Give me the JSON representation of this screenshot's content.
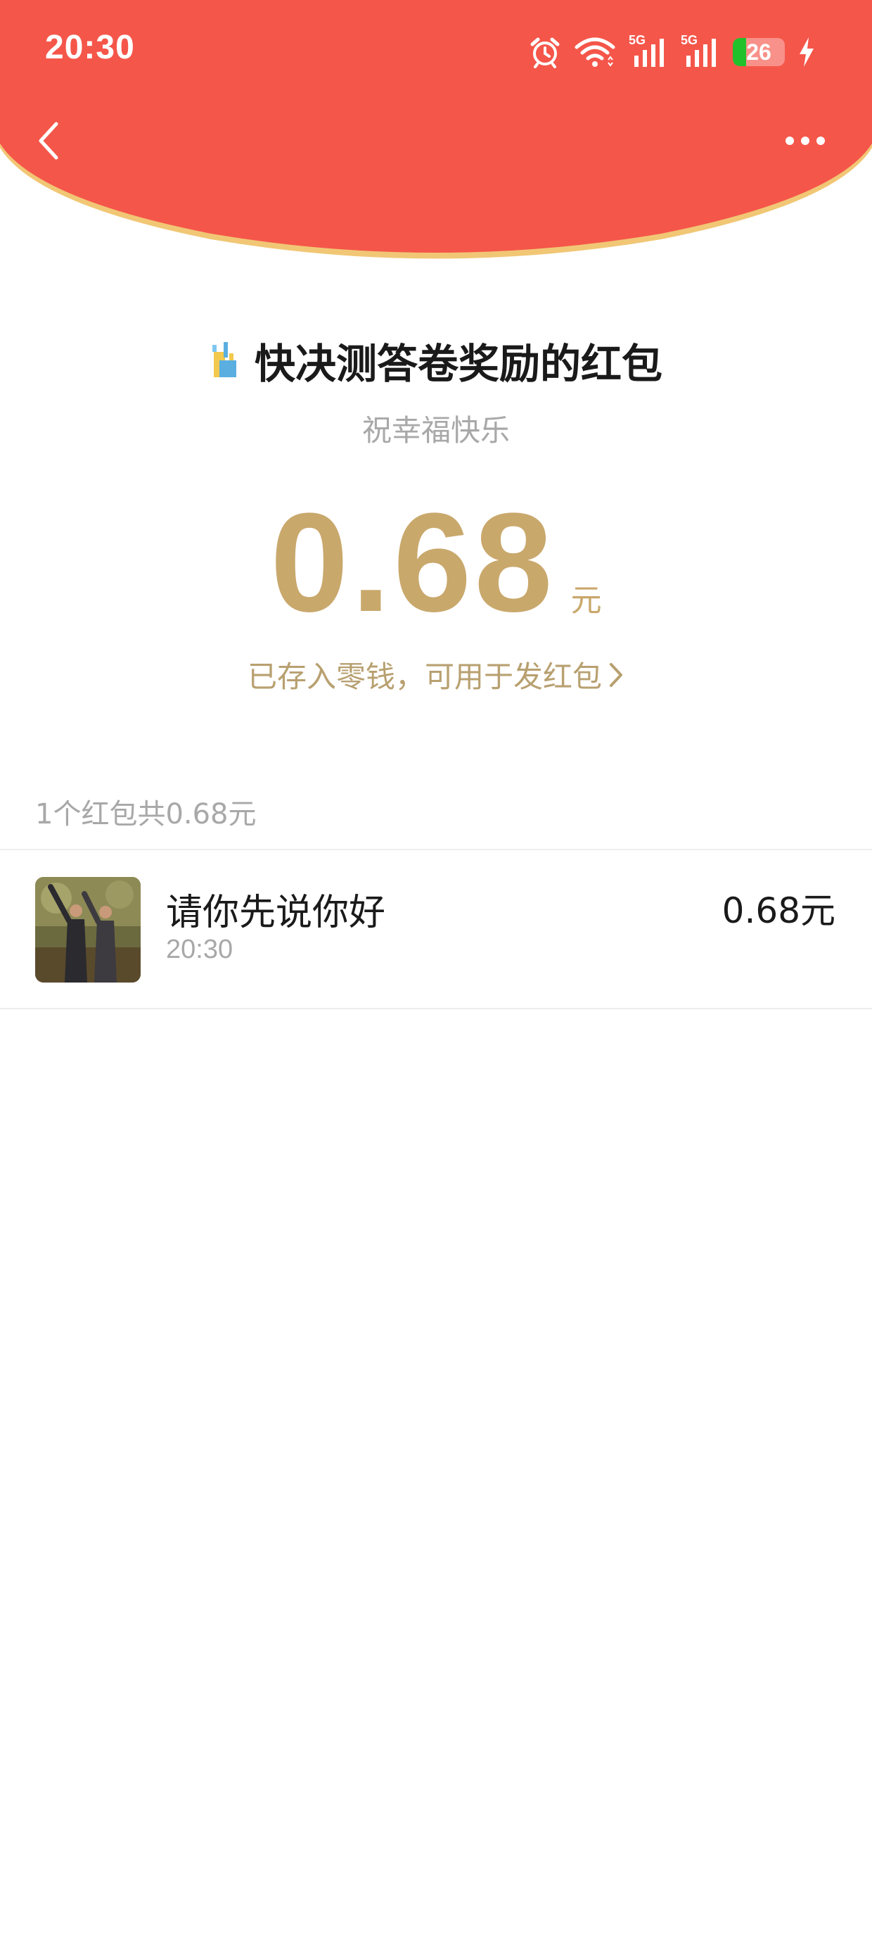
{
  "status_bar": {
    "time": "20:30",
    "battery_level": "26",
    "network_1": "5G",
    "network_2": "5G",
    "icons": [
      "alarm-icon",
      "wifi-icon",
      "signal-5g-icon",
      "signal-5g-icon",
      "battery-icon",
      "charging-icon"
    ]
  },
  "header": {
    "color": "#f5564a",
    "rim_color": "#f1c775",
    "back_icon": "back-arrow-icon",
    "more_icon": "more-dots-icon"
  },
  "red_packet": {
    "title": "快决测答卷奖励的红包",
    "wish": "祝幸福快乐",
    "amount": "0.68",
    "unit": "元",
    "stored_note": "已存入零钱，可用于发红包",
    "accent_color": "#c9a86c"
  },
  "summary": "1个红包共0.68元",
  "records": [
    {
      "name": "请你先说你好",
      "time": "20:30",
      "amount": "0.68元"
    }
  ]
}
